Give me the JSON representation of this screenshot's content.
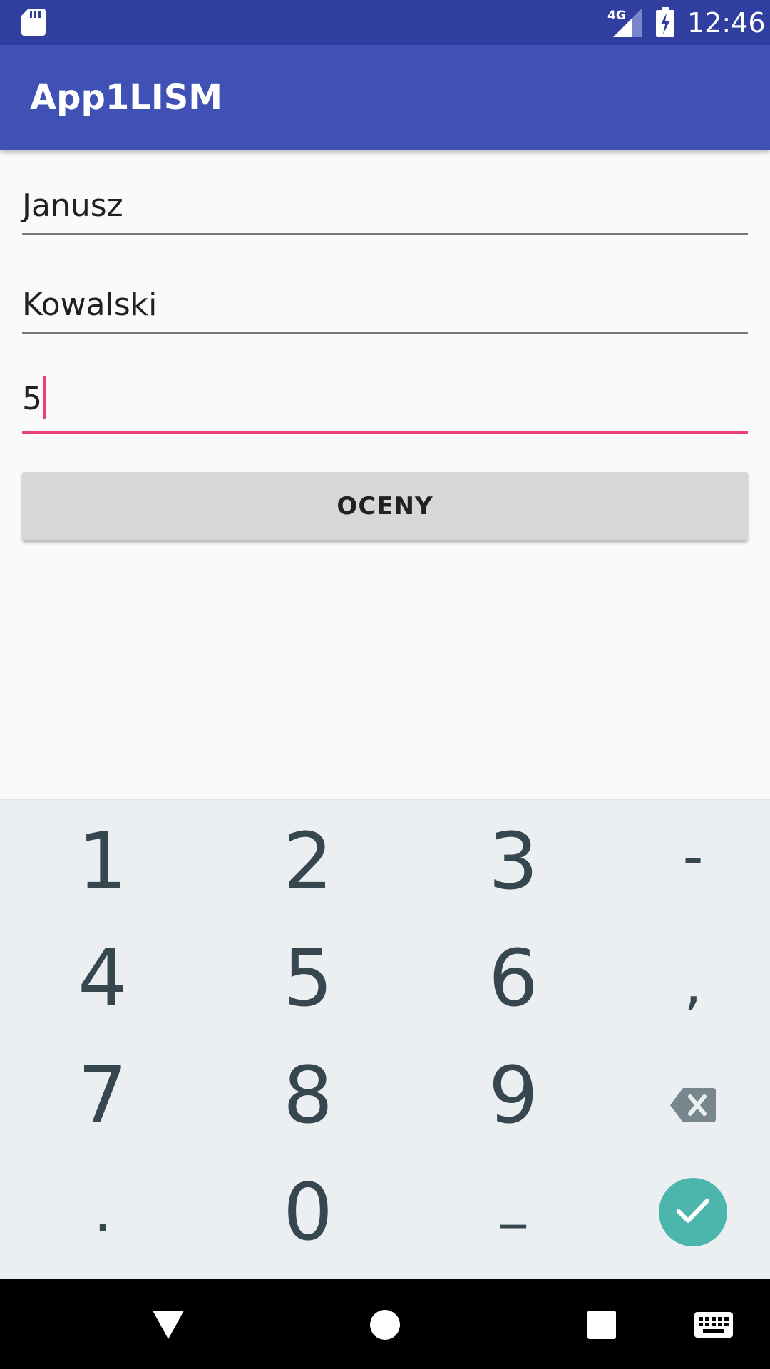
{
  "status_bar": {
    "network": "4G",
    "time": "12:46",
    "icons": [
      "sd-card-icon",
      "signal-icon",
      "battery-charging-icon"
    ]
  },
  "app_bar": {
    "title": "App1LISM"
  },
  "form": {
    "first_name": "Janusz",
    "last_name": "Kowalski",
    "grade": "5",
    "button_label": "OCENY"
  },
  "keyboard": {
    "keys": [
      "1",
      "2",
      "3",
      "-",
      "4",
      "5",
      "6",
      ",",
      "7",
      "8",
      "9",
      ".",
      "0",
      "_"
    ],
    "icons": [
      "backspace-icon",
      "check-icon"
    ]
  },
  "nav_bar": {
    "icons": [
      "back-icon",
      "home-icon",
      "recents-icon",
      "keyboard-icon"
    ]
  },
  "colors": {
    "status_bar": "#303f9f",
    "app_bar": "#3f51b5",
    "accent": "#ec407a",
    "enter_key": "#4db6ac"
  }
}
